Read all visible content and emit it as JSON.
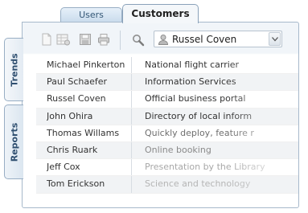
{
  "tabs": [
    {
      "label": "Users",
      "active": false
    },
    {
      "label": "Customers",
      "active": true
    }
  ],
  "side_tabs": [
    {
      "label": "Trends"
    },
    {
      "label": "Reports"
    }
  ],
  "toolbar": {
    "icons": [
      "new-document-icon",
      "grid-settings-icon",
      "save-icon",
      "print-icon",
      "search-icon"
    ],
    "select": {
      "value": "Russel Coven",
      "icon": "user-icon"
    }
  },
  "rows": [
    {
      "name": "Michael Pinkerton",
      "description": "National flight carrier",
      "desc_color": "#333333"
    },
    {
      "name": "Paul Schaefer",
      "description": "Information Services",
      "desc_color": "#333333"
    },
    {
      "name": "Russel Coven",
      "description": "Official business portal",
      "desc_color": "#333333"
    },
    {
      "name": "John Ohira",
      "description": "Directory of local inform",
      "desc_color": "#333333"
    },
    {
      "name": "Thomas Willams",
      "description": "Quickly deploy, feature r",
      "desc_color": "#6e6e6e"
    },
    {
      "name": "Chris Ruark",
      "description": "Online booking",
      "desc_color": "#8a8a8a"
    },
    {
      "name": "Jeff Cox",
      "description": "Presentation by the Library",
      "desc_color": "#a8a8a8"
    },
    {
      "name": "Tom Erickson",
      "description": "Science and technology",
      "desc_color": "#b5b5b5"
    }
  ],
  "colors": {
    "tab_border": "#98aec4",
    "side_tab_text": "#2f4f70",
    "row_alt": "#f1f3f5"
  }
}
